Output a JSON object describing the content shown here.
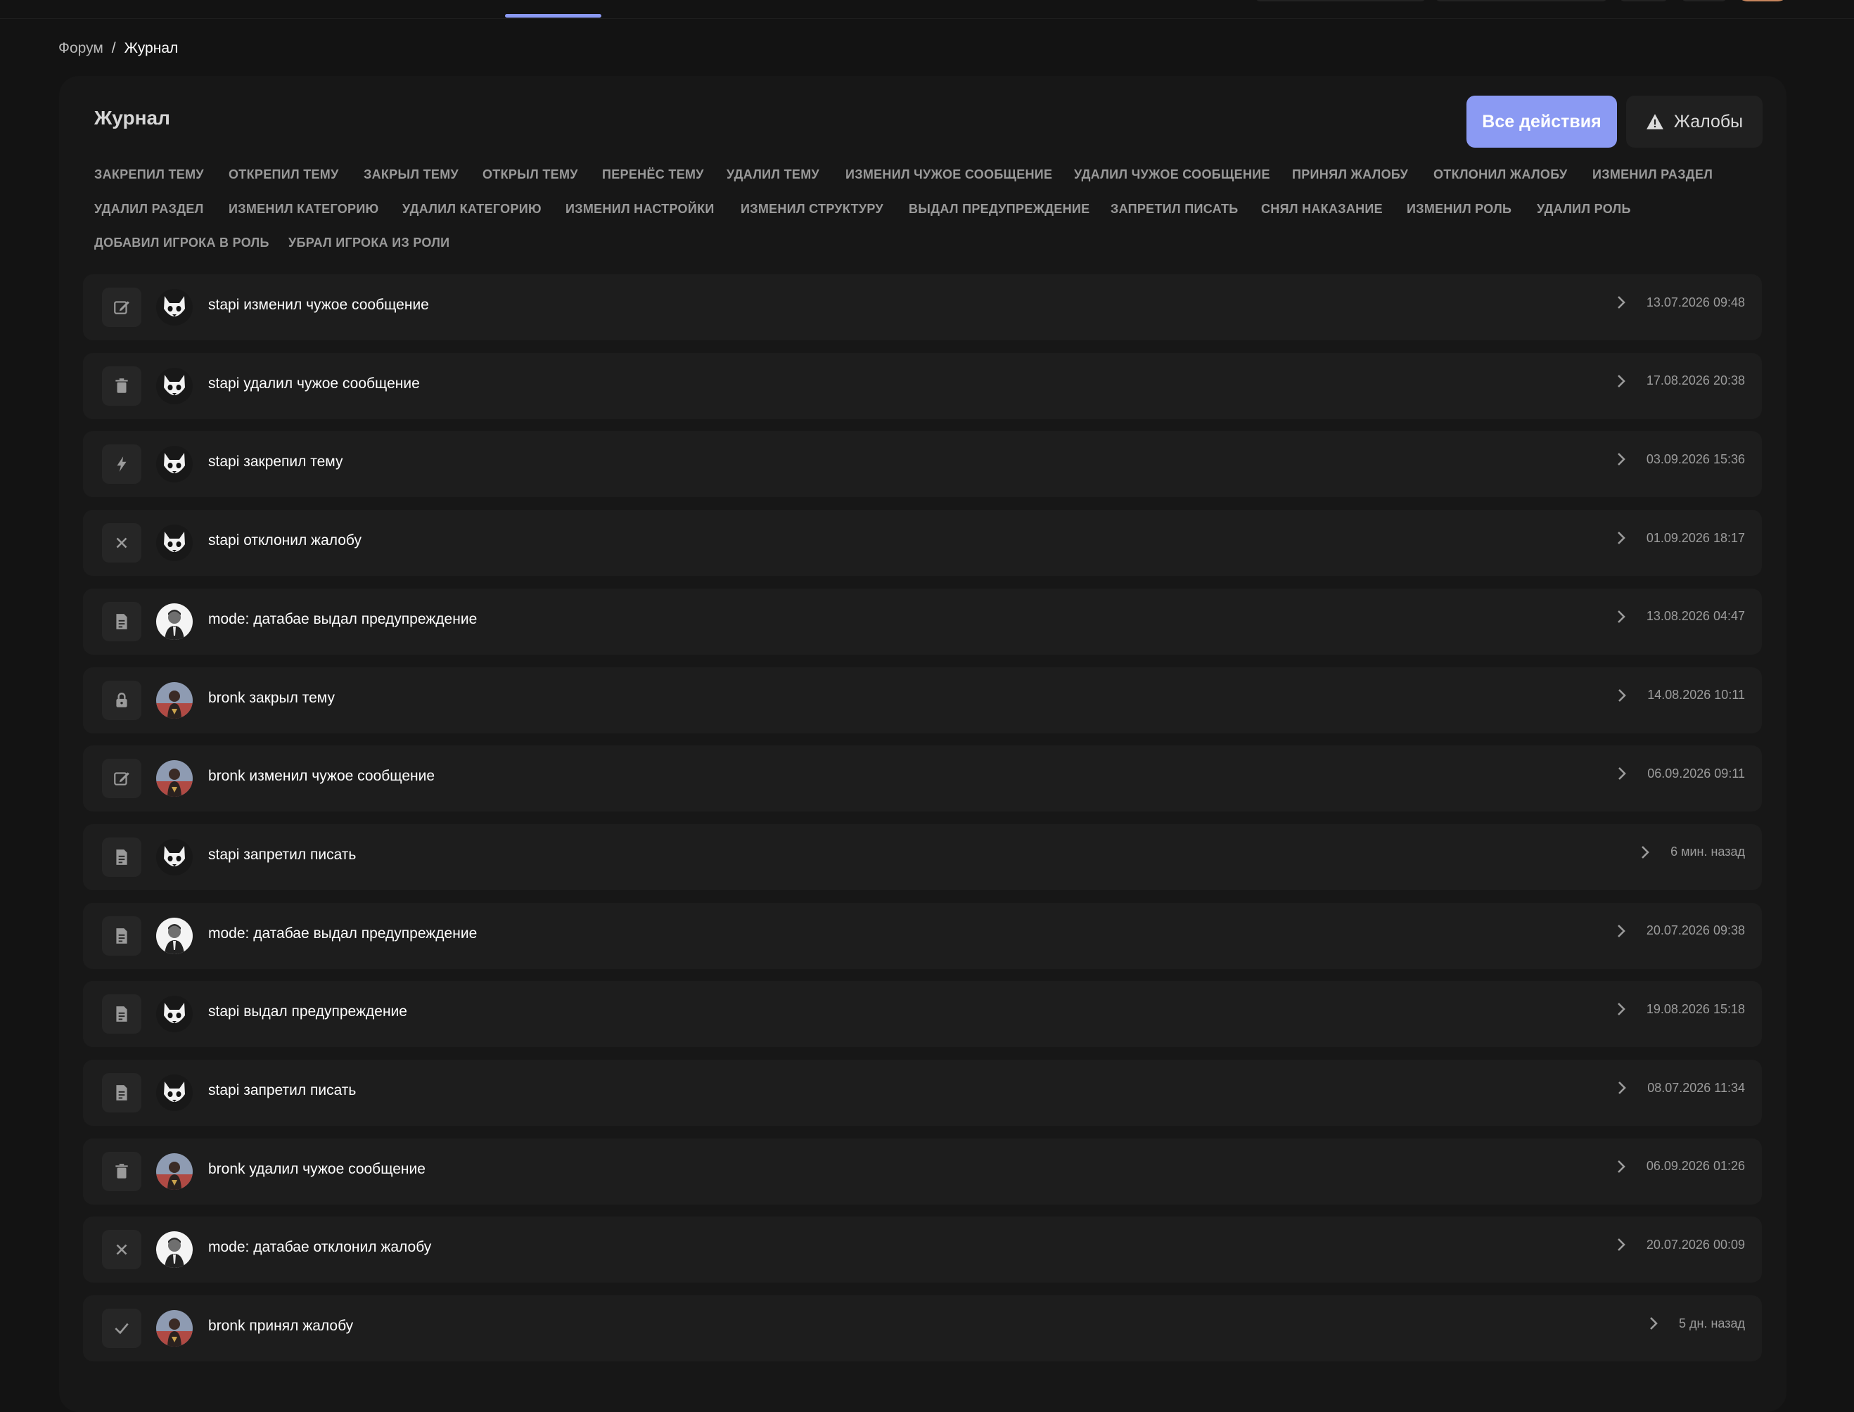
{
  "breadcrumb": {
    "root": "Форум",
    "separator": "/",
    "current": "Журнал"
  },
  "page": {
    "title": "Журнал"
  },
  "header_buttons": {
    "all_actions": "Все действия",
    "complaints": "Жалобы"
  },
  "filters": [
    "ЗАКРЕПИЛ ТЕМУ",
    "ОТКРЕПИЛ ТЕМУ",
    "ЗАКРЫЛ ТЕМУ",
    "ОТКРЫЛ ТЕМУ",
    "ПЕРЕНЁС ТЕМУ",
    "УДАЛИЛ ТЕМУ",
    "ИЗМЕНИЛ ЧУЖОЕ СООБЩЕНИЕ",
    "УДАЛИЛ ЧУЖОЕ СООБЩЕНИЕ",
    "ПРИНЯЛ ЖАЛОБУ",
    "ОТКЛОНИЛ ЖАЛОБУ",
    "ИЗМЕНИЛ РАЗДЕЛ",
    "УДАЛИЛ РАЗДЕЛ",
    "ИЗМЕНИЛ КАТЕГОРИЮ",
    "УДАЛИЛ КАТЕГОРИЮ",
    "ИЗМЕНИЛ НАСТРОЙКИ",
    "ИЗМЕНИЛ СТРУКТУРУ",
    "ВЫДАЛ ПРЕДУПРЕЖДЕНИЕ",
    "ЗАПРЕТИЛ ПИСАТЬ",
    "СНЯЛ НАКАЗАНИЕ",
    "ИЗМЕНИЛ РОЛЬ",
    "УДАЛИЛ РОЛЬ",
    "ДОБАВИЛ ИГРОКА В РОЛЬ",
    "УБРАЛ ИГРОКА ИЗ РОЛИ"
  ],
  "log_entries": [
    {
      "icon": "edit-icon",
      "avatar": "cat",
      "text": "stapi изменил чужое сообщение",
      "time": "13.07.2026 09:48"
    },
    {
      "icon": "trash-icon",
      "avatar": "cat",
      "text": "stapi удалил чужое сообщение",
      "time": "17.08.2026 20:38"
    },
    {
      "icon": "bolt-icon",
      "avatar": "cat",
      "text": "stapi закрепил тему",
      "time": "03.09.2026 15:36"
    },
    {
      "icon": "close-icon",
      "avatar": "cat",
      "text": "stapi отклонил жалобу",
      "time": "01.09.2026 18:17"
    },
    {
      "icon": "document-icon",
      "avatar": "man",
      "text": "mode: датабае выдал предупреждение",
      "time": "13.08.2026 04:47"
    },
    {
      "icon": "lock-icon",
      "avatar": "dark",
      "text": "bronk закрыл тему",
      "time": "14.08.2026 10:11"
    },
    {
      "icon": "edit-icon",
      "avatar": "dark",
      "text": "bronk изменил чужое сообщение",
      "time": "06.09.2026 09:11"
    },
    {
      "icon": "document-icon",
      "avatar": "cat",
      "text": "stapi запретил писать",
      "time": "6 мин. назад"
    },
    {
      "icon": "document-icon",
      "avatar": "man",
      "text": "mode: датабае выдал предупреждение",
      "time": "20.07.2026 09:38"
    },
    {
      "icon": "document-icon",
      "avatar": "cat",
      "text": "stapi выдал предупреждение",
      "time": "19.08.2026 15:18"
    },
    {
      "icon": "document-icon",
      "avatar": "cat",
      "text": "stapi запретил писать",
      "time": "08.07.2026 11:34"
    },
    {
      "icon": "trash-icon",
      "avatar": "dark",
      "text": "bronk удалил чужое сообщение",
      "time": "06.09.2026 01:26"
    },
    {
      "icon": "close-icon",
      "avatar": "man",
      "text": "mode: датабае отклонил жалобу",
      "time": "20.07.2026 00:09"
    },
    {
      "icon": "check-icon",
      "avatar": "dark",
      "text": "bronk принял жалобу",
      "time": "5 дн. назад"
    }
  ],
  "colors": {
    "accent": "#8b9af3",
    "background": "#131313",
    "panel": "#171717",
    "row": "#1d1d1d"
  }
}
